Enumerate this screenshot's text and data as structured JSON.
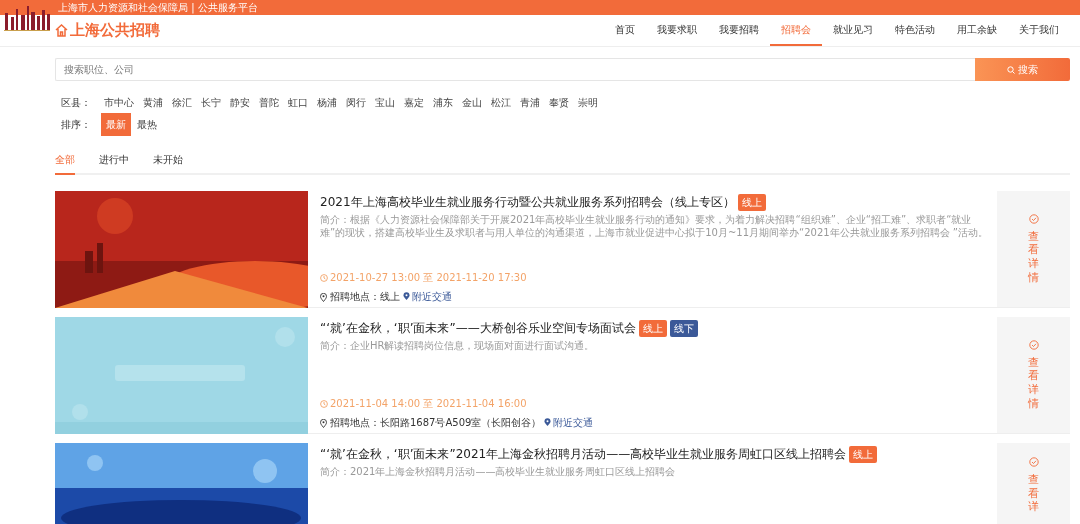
{
  "top_bar": {
    "text": "上海市人力资源和社会保障局 | 公共服务平台"
  },
  "site_title": "上海公共招聘",
  "nav": [
    {
      "label": "首页",
      "selected": false
    },
    {
      "label": "我要求职",
      "selected": false
    },
    {
      "label": "我要招聘",
      "selected": false
    },
    {
      "label": "招聘会",
      "selected": true
    },
    {
      "label": "就业见习",
      "selected": false
    },
    {
      "label": "特色活动",
      "selected": false
    },
    {
      "label": "用工余缺",
      "selected": false
    },
    {
      "label": "关于我们",
      "selected": false
    }
  ],
  "search": {
    "placeholder": "搜索职位、公司",
    "button": "搜索"
  },
  "district": {
    "label": "区县：",
    "options": [
      "市中心",
      "黄浦",
      "徐汇",
      "长宁",
      "静安",
      "普陀",
      "虹口",
      "杨浦",
      "闵行",
      "宝山",
      "嘉定",
      "浦东",
      "金山",
      "松江",
      "青浦",
      "奉贤",
      "崇明"
    ]
  },
  "sort": {
    "label": "排序：",
    "options": [
      {
        "label": "最新",
        "selected": true
      },
      {
        "label": "最热",
        "selected": false
      }
    ]
  },
  "tabs": [
    {
      "label": "全部",
      "selected": true
    },
    {
      "label": "进行中",
      "selected": false
    },
    {
      "label": "未开始",
      "selected": false
    }
  ],
  "fairs": [
    {
      "image": {
        "kind": "picture"
      },
      "title": "2021年上海高校毕业生就业服务行动暨公共就业服务系列招聘会（线上专区）",
      "tags": [
        {
          "label": "线上",
          "color": "#f26b3a"
        }
      ],
      "intro": "简介：根据《人力资源社会保障部关于开展2021年高校毕业生就业服务行动的通知》要求，为着力解决招聘“组织难”、企业“招工难”、求职者“就业难”的现状，搭建高校毕业生及求职者与用人单位的沟通渠道，上海市就业促进中心拟于10月~11月期间举办“2021年公共就业服务系列招聘会 ”活动。",
      "time": "2021-10-27 13:00 至 2021-11-20 17:30",
      "location": "招聘地点：线上",
      "transit": "附近交通",
      "detail": "查看详情"
    },
    {
      "image": {
        "kind": "picture"
      },
      "title": "“‘就’在金秋，‘职’面未来”——大桥创谷乐业空间专场面试会",
      "tags": [
        {
          "label": "线上",
          "color": "#f26b3a"
        },
        {
          "label": "线下",
          "color": "#3b5998"
        }
      ],
      "intro": "简介：企业HR解读招聘岗位信息，现场面对面进行面试沟通。",
      "time": "2021-11-04 14:00 至 2021-11-04 16:00",
      "location": "招聘地点：长阳路1687号A509室（长阳创谷）",
      "transit": "附近交通",
      "detail": "查看详情"
    },
    {
      "image": {
        "kind": "picture"
      },
      "title": "“‘就’在金秋，‘职’面未来”2021年上海金秋招聘月活动——高校毕业生就业服务周虹口区线上招聘会",
      "tags": [
        {
          "label": "线上",
          "color": "#f26b3a"
        }
      ],
      "intro": "简介：2021年上海金秋招聘月活动——高校毕业生就业服务周虹口区线上招聘会",
      "detail": "查看详"
    }
  ]
}
